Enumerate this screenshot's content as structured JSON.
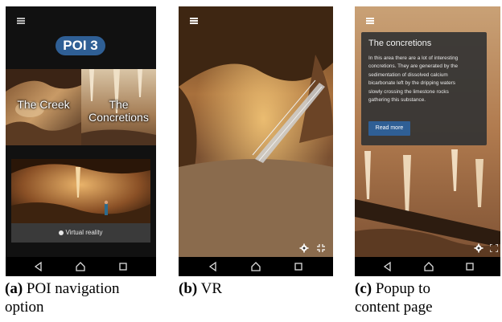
{
  "panel_a": {
    "poi_title": "POI 3",
    "tile_creek": "The Creek",
    "tile_concretions_line1": "The",
    "tile_concretions_line2": "Concretions",
    "vr_button_label": "Virtual reality",
    "caption_prefix": "(a)",
    "caption_text_line1": "POI navigation",
    "caption_text_line2": "option"
  },
  "panel_b": {
    "caption_prefix": "(b)",
    "caption_text": "VR"
  },
  "panel_c": {
    "popup_title": "The concretions",
    "popup_body_lines": [
      "In this area there are a lot of interesting",
      "concretions. They are generated by the",
      "sedimentation of dissolved calcium",
      "bicarbonate left by the dripping waters",
      "slowly crossing the limestone rocks",
      "gathering this substance."
    ],
    "read_more_label": "Read more",
    "caption_prefix": "(c)",
    "caption_text_line1": "Popup to",
    "caption_text_line2": "content page"
  },
  "icons": [
    "menu-icon",
    "back-icon",
    "home-icon",
    "recents-icon",
    "gear-icon",
    "fullscreen-exit-icon",
    "fullscreen-icon",
    "vr-headset-icon"
  ],
  "colors": {
    "accent": "#2f5f95",
    "navbar": "#000000",
    "popup_bg": "#343434"
  }
}
